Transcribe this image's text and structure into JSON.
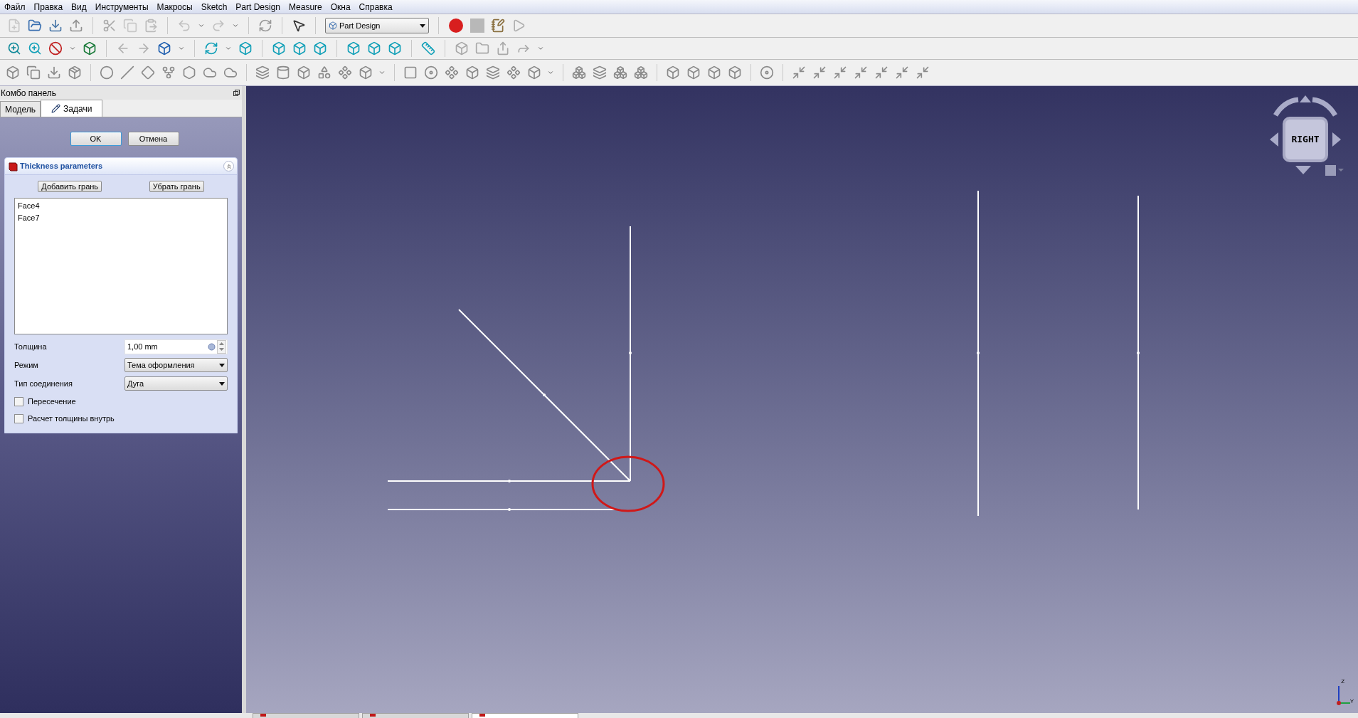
{
  "menu": [
    "Файл",
    "Правка",
    "Вид",
    "Инструменты",
    "Макросы",
    "Sketch",
    "Part Design",
    "Measure",
    "Окна",
    "Справка"
  ],
  "workbench": "Part Design",
  "combo_panel": {
    "title": "Комбо панель",
    "tabs": [
      {
        "label": "Модель",
        "selected": false
      },
      {
        "label": "Задачи",
        "selected": true
      }
    ]
  },
  "dialog_buttons": [
    "OK",
    "Отмена"
  ],
  "thickness": {
    "title": "Thickness parameters",
    "expanded": true,
    "buttons": [
      "Добавить грань",
      "Убрать грань"
    ],
    "faces": [
      "Face4",
      "Face7"
    ],
    "fields": [
      {
        "kind": "spin",
        "label": "Толщина",
        "value": "1,00 mm"
      },
      {
        "kind": "combo",
        "label": "Режим",
        "value": "Тема оформления"
      },
      {
        "kind": "combo",
        "label": "Тип соединения",
        "value": "Дуга"
      },
      {
        "kind": "check",
        "label": "Пересечение",
        "checked": false
      },
      {
        "kind": "check",
        "label": "Расчет толщины внутрь",
        "checked": false
      }
    ]
  },
  "nav_cube": {
    "face": "RIGHT"
  },
  "axes": [
    "Z",
    "Y"
  ],
  "document_tabs": [
    {
      "selected": false
    },
    {
      "selected": false
    },
    {
      "selected": true
    }
  ]
}
